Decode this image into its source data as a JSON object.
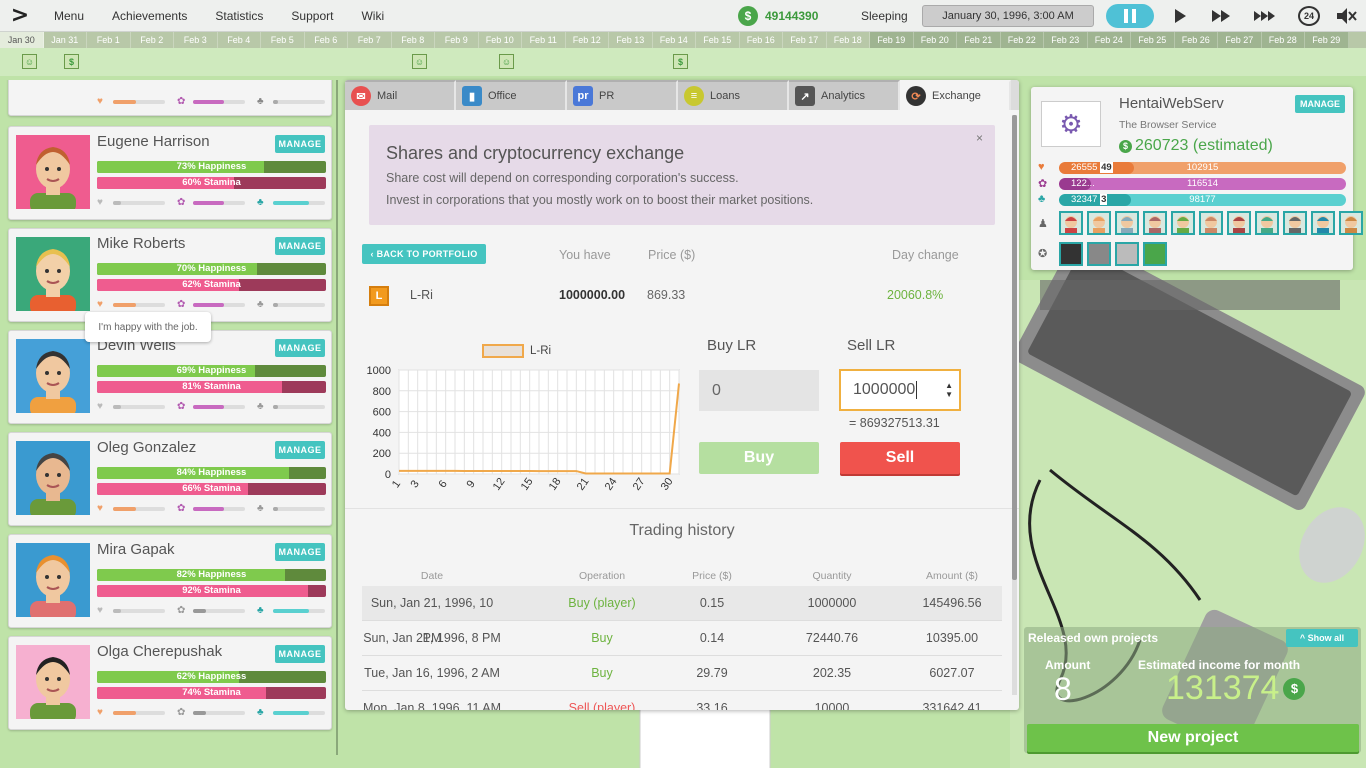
{
  "topbar": {
    "logo": ">",
    "nav": [
      "Menu",
      "Achievements",
      "Statistics",
      "Support",
      "Wiki"
    ],
    "money": "49144390",
    "money_icon": "$",
    "status": "Sleeping",
    "datetime": "January 30, 1996, 3:00 AM",
    "speed_badge": "24"
  },
  "timeline": {
    "days": [
      "Jan 30",
      "Jan 31",
      "Feb 1",
      "Feb 2",
      "Feb 3",
      "Feb 4",
      "Feb 5",
      "Feb 6",
      "Feb 7",
      "Feb 8",
      "Feb 9",
      "Feb 10",
      "Feb 11",
      "Feb 12",
      "Feb 13",
      "Feb 14",
      "Feb 15",
      "Feb 16",
      "Feb 17",
      "Feb 18",
      "Feb 19",
      "Feb 20",
      "Feb 21",
      "Feb 22",
      "Feb 23",
      "Feb 24",
      "Feb 25",
      "Feb 26",
      "Feb 27",
      "Feb 28",
      "Feb 29"
    ]
  },
  "employees": {
    "manage_label": "MANAGE",
    "tooltip": "I'm happy with the job.",
    "list": [
      {
        "name": "Eugene Harrison",
        "happiness": "73% Happiness",
        "happiness_value": 73,
        "stamina": "60% Stamina",
        "stamina_value": 60
      },
      {
        "name": "Mike Roberts",
        "happiness": "70% Happiness",
        "happiness_value": 70,
        "stamina": "62% Stamina",
        "stamina_value": 62
      },
      {
        "name": "Devin Wells",
        "happiness": "69% Happiness",
        "happiness_value": 69,
        "stamina": "81% Stamina",
        "stamina_value": 81
      },
      {
        "name": "Oleg Gonzalez",
        "happiness": "84% Happiness",
        "happiness_value": 84,
        "stamina": "66% Stamina",
        "stamina_value": 66
      },
      {
        "name": "Mira Gapak",
        "happiness": "82% Happiness",
        "happiness_value": 82,
        "stamina": "92% Stamina",
        "stamina_value": 92
      },
      {
        "name": "Olga Cherepushak",
        "happiness": "62% Happiness",
        "happiness_value": 62,
        "stamina": "74% Stamina",
        "stamina_value": 74
      }
    ]
  },
  "tabs": [
    "Mail",
    "Office",
    "PR",
    "Loans",
    "Analytics",
    "Exchange"
  ],
  "exchange": {
    "info_title": "Shares and cryptocurrency exchange",
    "info_line1": "Share cost will depend on corresponding corporation's success.",
    "info_line2": "Invest in corporations that you mostly work on to boost their market positions.",
    "info_close": "×",
    "back_label": "BACK TO PORTFOLIO",
    "col_you_have": "You have",
    "col_price": "Price ($)",
    "col_day_change": "Day change",
    "stock_name": "L-Ri",
    "stock_icon_letter": "L",
    "you_have": "1000000.00",
    "price": "869.33",
    "day_change": "20060.8%",
    "buy_label": "Buy LR",
    "sell_label": "Sell LR",
    "buy_value": "0",
    "sell_value": "1000000",
    "sell_total": "= 869327513.31",
    "buy_button": "Buy",
    "sell_button": "Sell",
    "trading_history_title": "Trading history",
    "history_headers": [
      "Date",
      "Operation",
      "Price ($)",
      "Quantity",
      "Amount ($)"
    ],
    "history": [
      {
        "date": "Sun, Jan 21, 1996, 10 PM",
        "operation": "Buy (player)",
        "price": "0.15",
        "quantity": "1000000",
        "amount": "145496.56"
      },
      {
        "date": "Sun, Jan 21, 1996, 8 PM",
        "operation": "Buy",
        "price": "0.14",
        "quantity": "72440.76",
        "amount": "10395.00"
      },
      {
        "date": "Tue, Jan 16, 1996, 2 AM",
        "operation": "Buy",
        "price": "29.79",
        "quantity": "202.35",
        "amount": "6027.07"
      },
      {
        "date": "Mon, Jan 8, 1996, 11 AM",
        "operation": "Sell (player)",
        "price": "33.16",
        "quantity": "10000",
        "amount": "331642.41"
      }
    ]
  },
  "chart_data": {
    "type": "line",
    "title": "",
    "series": [
      {
        "name": "L-Ri",
        "color": "#f0a84a",
        "values": [
          30,
          30,
          30,
          30,
          30,
          30,
          30,
          29,
          29,
          29,
          29,
          29,
          29,
          29,
          29,
          28,
          28,
          28,
          28,
          28,
          5,
          5,
          5,
          5,
          5,
          5,
          5,
          5,
          5,
          5,
          870
        ]
      }
    ],
    "x": [
      1,
      2,
      3,
      4,
      5,
      6,
      7,
      8,
      9,
      10,
      11,
      12,
      13,
      14,
      15,
      16,
      17,
      18,
      19,
      20,
      21,
      22,
      23,
      24,
      25,
      26,
      27,
      28,
      29,
      30,
      31
    ],
    "x_ticks": [
      "1",
      "3",
      "6",
      "9",
      "12",
      "15",
      "18",
      "21",
      "24",
      "27",
      "30"
    ],
    "y_ticks": [
      "0",
      "200",
      "400",
      "600",
      "800",
      "1000"
    ],
    "ylim": [
      0,
      1000
    ],
    "grid": true,
    "legend": "top-center"
  },
  "project": {
    "name": "HentaiWebServ",
    "description": "The Browser Service",
    "value": "260723 (estimated)",
    "manage_label": "MANAGE",
    "bars": [
      {
        "left": "26555",
        "mid": "49",
        "right": "102915",
        "color": "#f0a06a",
        "dark": "#e97b3a",
        "fraction": 0.26
      },
      {
        "left": "122...",
        "mid": "52",
        "right": "116514",
        "color": "#c86ac0",
        "dark": "#9a3a90",
        "fraction": 0.11
      },
      {
        "left": "32347",
        "mid": "3",
        "right": "98177",
        "color": "#5ad0d0",
        "dark": "#2aa6a6",
        "fraction": 0.25
      }
    ]
  },
  "released": {
    "title": "Released own projects",
    "show_all": "Show all",
    "amount_label": "Amount",
    "amount": "8",
    "income_label": "Estimated income for month",
    "income": "131374",
    "new_project": "New project"
  }
}
